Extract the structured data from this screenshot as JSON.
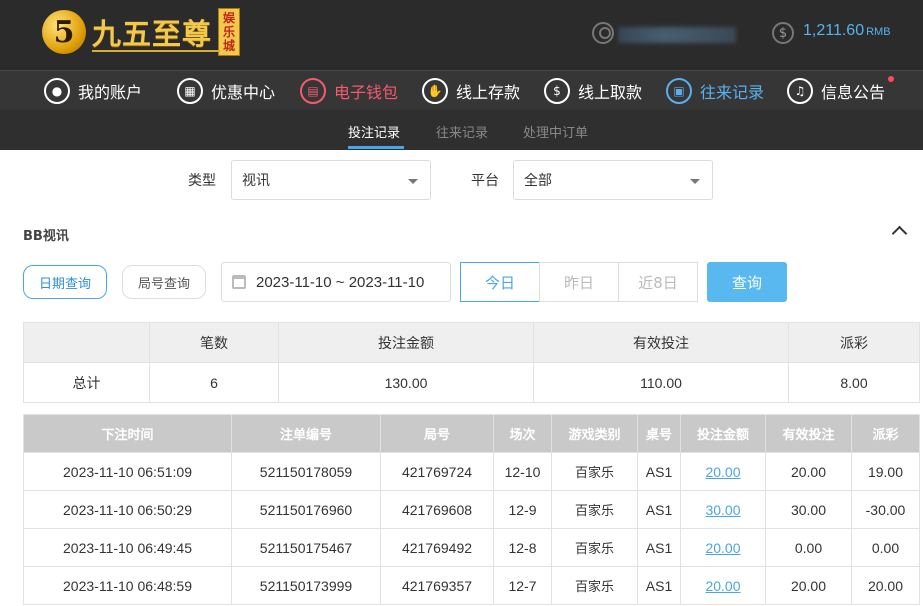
{
  "brand": {
    "logo_number": "5",
    "name": "九五至尊",
    "badge": [
      "娱",
      "乐",
      "城"
    ]
  },
  "account": {
    "balance": "1,211.60",
    "currency": "RMB"
  },
  "nav": [
    {
      "label": "我的账户",
      "icon": "user-icon"
    },
    {
      "label": "优惠中心",
      "icon": "gift-icon"
    },
    {
      "label": "电子钱包",
      "icon": "wallet-icon"
    },
    {
      "label": "线上存款",
      "icon": "deposit-icon"
    },
    {
      "label": "线上取款",
      "icon": "withdraw-icon"
    },
    {
      "label": "往来记录",
      "icon": "record-icon"
    },
    {
      "label": "信息公告",
      "icon": "bell-icon"
    }
  ],
  "subtabs": [
    "投注记录",
    "往来记录",
    "处理中订单"
  ],
  "filters": {
    "type_label": "类型",
    "type_value": "视讯",
    "platform_label": "平台",
    "platform_value": "全部"
  },
  "section_title": "BB视讯",
  "query": {
    "mode_date": "日期查询",
    "mode_round": "局号查询",
    "date_range": "2023-11-10 ~ 2023-11-10",
    "quick": [
      "今日",
      "昨日",
      "近8日"
    ],
    "submit": "查询"
  },
  "summary": {
    "headers": [
      "",
      "笔数",
      "投注金额",
      "有效投注",
      "派彩"
    ],
    "row": [
      "总计",
      "6",
      "130.00",
      "110.00",
      "8.00"
    ]
  },
  "detail": {
    "headers": [
      "下注时间",
      "注单编号",
      "局号",
      "场次",
      "游戏类别",
      "桌号",
      "投注金额",
      "有效投注",
      "派彩"
    ],
    "rows": [
      [
        "2023-11-10 06:51:09",
        "521150178059",
        "421769724",
        "12-10",
        "百家乐",
        "AS1",
        "20.00",
        "20.00",
        "19.00"
      ],
      [
        "2023-11-10 06:50:29",
        "521150176960",
        "421769608",
        "12-9",
        "百家乐",
        "AS1",
        "30.00",
        "30.00",
        "-30.00"
      ],
      [
        "2023-11-10 06:49:45",
        "521150175467",
        "421769492",
        "12-8",
        "百家乐",
        "AS1",
        "20.00",
        "0.00",
        "0.00"
      ],
      [
        "2023-11-10 06:48:59",
        "521150173999",
        "421769357",
        "12-7",
        "百家乐",
        "AS1",
        "20.00",
        "20.00",
        "20.00"
      ]
    ]
  },
  "colors": {
    "accent": "#49a6e8",
    "nav_highlight_red": "#f55a6e",
    "negative": "#e04848"
  }
}
